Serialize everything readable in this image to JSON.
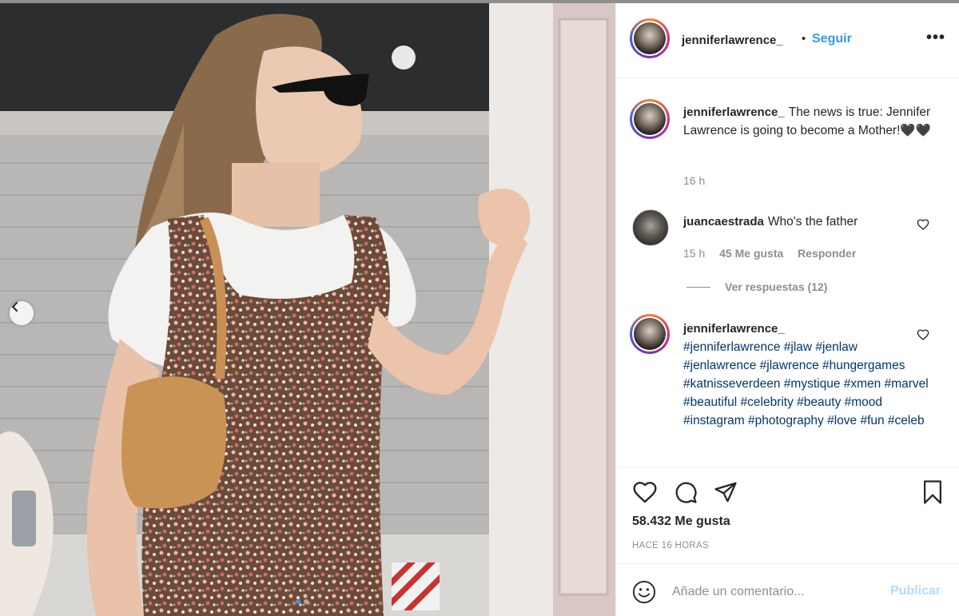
{
  "post": {
    "username": "jenniferlawrence_",
    "separator": "•",
    "follow_label": "Seguir",
    "more_icon": "more-options-icon"
  },
  "comments": {
    "caption": {
      "username": "jenniferlawrence_",
      "text": "The news is true: Jennifer Lawrence is going to become a Mother!🖤🖤",
      "time": "16 h"
    },
    "comment1": {
      "username": "juancaestrada",
      "text": "Who's the father",
      "time": "15 h",
      "likes": "45 Me gusta",
      "reply": "Responder",
      "view_replies": "Ver respuestas (12)"
    },
    "comment2": {
      "username": "jenniferlawrence_",
      "hashtags": "#jenniferlawrence #jlaw #jenlaw #jenlawrence #jlawrence #hungergames #katnisseverdeen #mystique #xmen #marvel #beautiful #celebrity #beauty #mood #instagram #photography #love #fun #celeb"
    }
  },
  "actions": {
    "likes_count": "58.432 Me gusta",
    "timestamp": "HACE 16 HORAS",
    "comment_placeholder": "Añade un comentario...",
    "publish_label": "Publicar"
  },
  "colors": {
    "link_blue": "#3897f0",
    "hashtag_blue": "#00376b",
    "muted_gray": "#8e8e8e",
    "publish_disabled": "#b3dbff"
  }
}
